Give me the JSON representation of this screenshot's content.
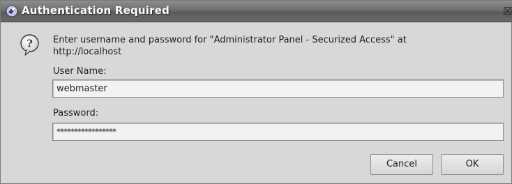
{
  "window": {
    "title": "Authentication Required",
    "close_glyph": "☒"
  },
  "dialog": {
    "message": "Enter username and password for \"Administrator Panel - Securized Access\" at http://localhost",
    "icon": "question-icon"
  },
  "form": {
    "username_label": "User Name:",
    "username_value": "webmaster",
    "password_label": "Password:",
    "password_value": "*****************"
  },
  "buttons": {
    "cancel_label": "Cancel",
    "ok_label": "OK"
  }
}
